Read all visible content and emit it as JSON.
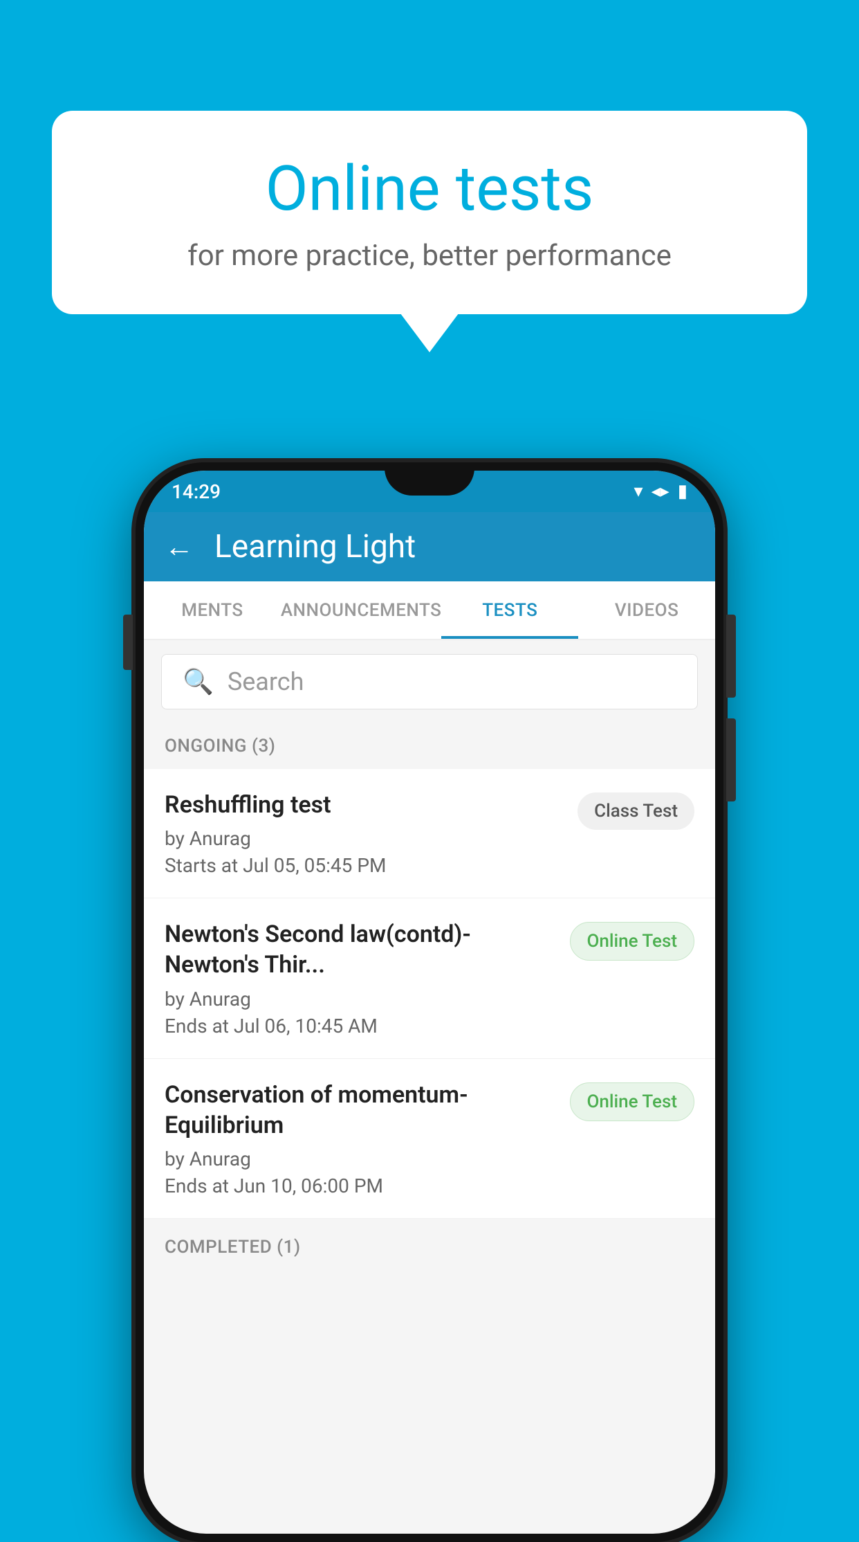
{
  "background": {
    "color": "#00AEDE"
  },
  "speech_bubble": {
    "title": "Online tests",
    "subtitle": "for more practice, better performance"
  },
  "phone": {
    "status_bar": {
      "time": "14:29",
      "wifi": "▾",
      "signal": "▴",
      "battery": "▮"
    },
    "app_header": {
      "back_label": "←",
      "title": "Learning Light"
    },
    "tabs": [
      {
        "label": "MENTS",
        "active": false
      },
      {
        "label": "ANNOUNCEMENTS",
        "active": false
      },
      {
        "label": "TESTS",
        "active": true
      },
      {
        "label": "VIDEOS",
        "active": false
      }
    ],
    "search": {
      "placeholder": "Search"
    },
    "ongoing_section": {
      "label": "ONGOING (3)"
    },
    "tests": [
      {
        "name": "Reshuffling test",
        "author": "by Anurag",
        "time_label": "Starts at",
        "time": "Jul 05, 05:45 PM",
        "badge": "Class Test",
        "badge_type": "class"
      },
      {
        "name": "Newton's Second law(contd)-Newton's Thir...",
        "author": "by Anurag",
        "time_label": "Ends at",
        "time": "Jul 06, 10:45 AM",
        "badge": "Online Test",
        "badge_type": "online"
      },
      {
        "name": "Conservation of momentum-Equilibrium",
        "author": "by Anurag",
        "time_label": "Ends at",
        "time": "Jun 10, 06:00 PM",
        "badge": "Online Test",
        "badge_type": "online"
      }
    ],
    "completed_section": {
      "label": "COMPLETED (1)"
    }
  }
}
